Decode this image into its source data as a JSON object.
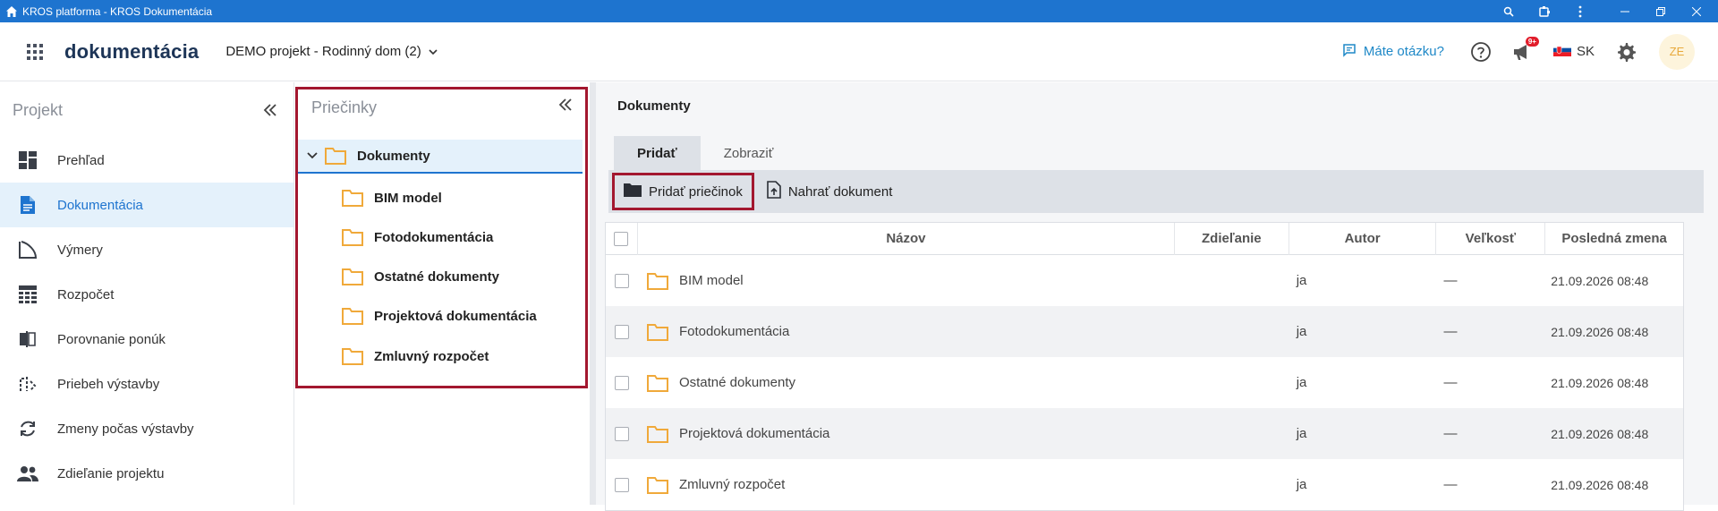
{
  "window": {
    "title": "KROS platforma - KROS Dokumentácia",
    "icons": [
      "home-icon",
      "zoom-icon",
      "extension-icon",
      "more-icon",
      "minimize-icon",
      "restore-icon",
      "close-icon"
    ]
  },
  "header": {
    "brand": "dokumentácia",
    "project": "DEMO projekt - Rodinný dom (2)",
    "help_label": "Máte otázku?",
    "notifications_badge": "9+",
    "language": "SK",
    "avatar_initials": "ZE"
  },
  "nav": {
    "title": "Projekt",
    "items": [
      {
        "label": "Prehľad",
        "icon": "dashboard-icon",
        "active": false
      },
      {
        "label": "Dokumentácia",
        "icon": "document-icon",
        "active": true
      },
      {
        "label": "Výmery",
        "icon": "measure-icon",
        "active": false
      },
      {
        "label": "Rozpočet",
        "icon": "budget-icon",
        "active": false
      },
      {
        "label": "Porovnanie ponúk",
        "icon": "compare-icon",
        "active": false
      },
      {
        "label": "Priebeh výstavby",
        "icon": "progress-icon",
        "active": false
      },
      {
        "label": "Zmeny počas výstavby",
        "icon": "changes-icon",
        "active": false
      },
      {
        "label": "Zdieľanie projektu",
        "icon": "people-icon",
        "active": false
      }
    ]
  },
  "folders": {
    "title": "Priečinky",
    "root": "Dokumenty",
    "children": [
      "BIM model",
      "Fotodokumentácia",
      "Ostatné dokumenty",
      "Projektová dokumentácia",
      "Zmluvný rozpočet"
    ]
  },
  "main": {
    "title": "Dokumenty",
    "tabs": [
      {
        "label": "Pridať",
        "active": true
      },
      {
        "label": "Zobraziť",
        "active": false
      }
    ],
    "toolbar": {
      "add_folder": "Pridať priečinok",
      "upload": "Nahrať dokument"
    },
    "table": {
      "columns": [
        "Názov",
        "Zdieľanie",
        "Autor",
        "Veľkosť",
        "Posledná zmena"
      ],
      "rows": [
        {
          "name": "BIM model",
          "share": "",
          "author": "ja",
          "size": "—",
          "modified": "21.09.2026 08:48"
        },
        {
          "name": "Fotodokumentácia",
          "share": "",
          "author": "ja",
          "size": "—",
          "modified": "21.09.2026 08:48"
        },
        {
          "name": "Ostatné dokumenty",
          "share": "",
          "author": "ja",
          "size": "—",
          "modified": "21.09.2026 08:48"
        },
        {
          "name": "Projektová dokumentácia",
          "share": "",
          "author": "ja",
          "size": "—",
          "modified": "21.09.2026 08:48"
        },
        {
          "name": "Zmluvný rozpočet",
          "share": "",
          "author": "ja",
          "size": "—",
          "modified": "21.09.2026 08:48"
        }
      ]
    }
  },
  "colors": {
    "titlebar": "#1e74cf",
    "brand": "#1d3557",
    "accent": "#1e74cf",
    "highlight_frame": "#a3172f",
    "folder": "#f0a93a",
    "active_bg": "#e4f1fb"
  }
}
